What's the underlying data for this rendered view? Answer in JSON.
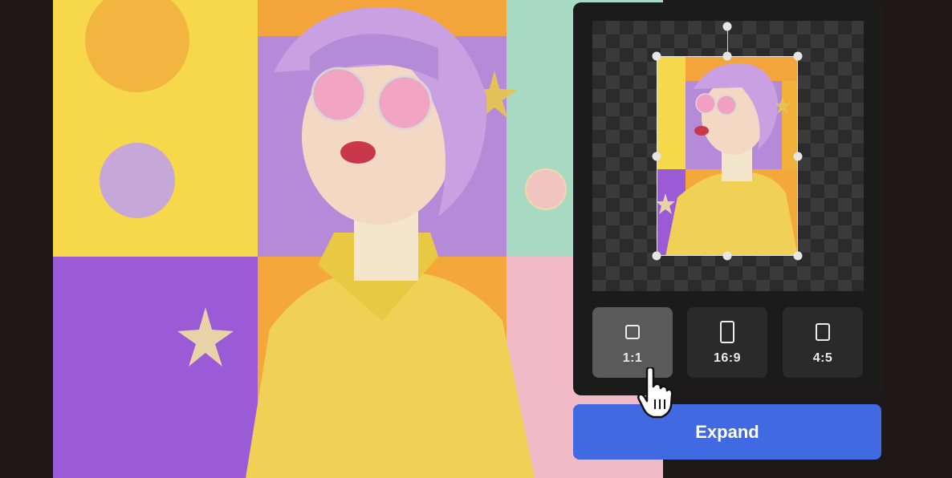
{
  "ratio_options": [
    {
      "label": "1:1",
      "icon": "square-ratio-icon",
      "active": true
    },
    {
      "label": "16:9",
      "icon": "portrait-ratio-icon",
      "active": false
    },
    {
      "label": "4:5",
      "icon": "portrait-short-ratio-icon",
      "active": false
    }
  ],
  "actions": {
    "expand_label": "Expand"
  },
  "colors": {
    "accent": "#4169e1",
    "panel": "#1b1b1c",
    "button": "#2a2a2b",
    "button_active": "#5a5a5b"
  }
}
